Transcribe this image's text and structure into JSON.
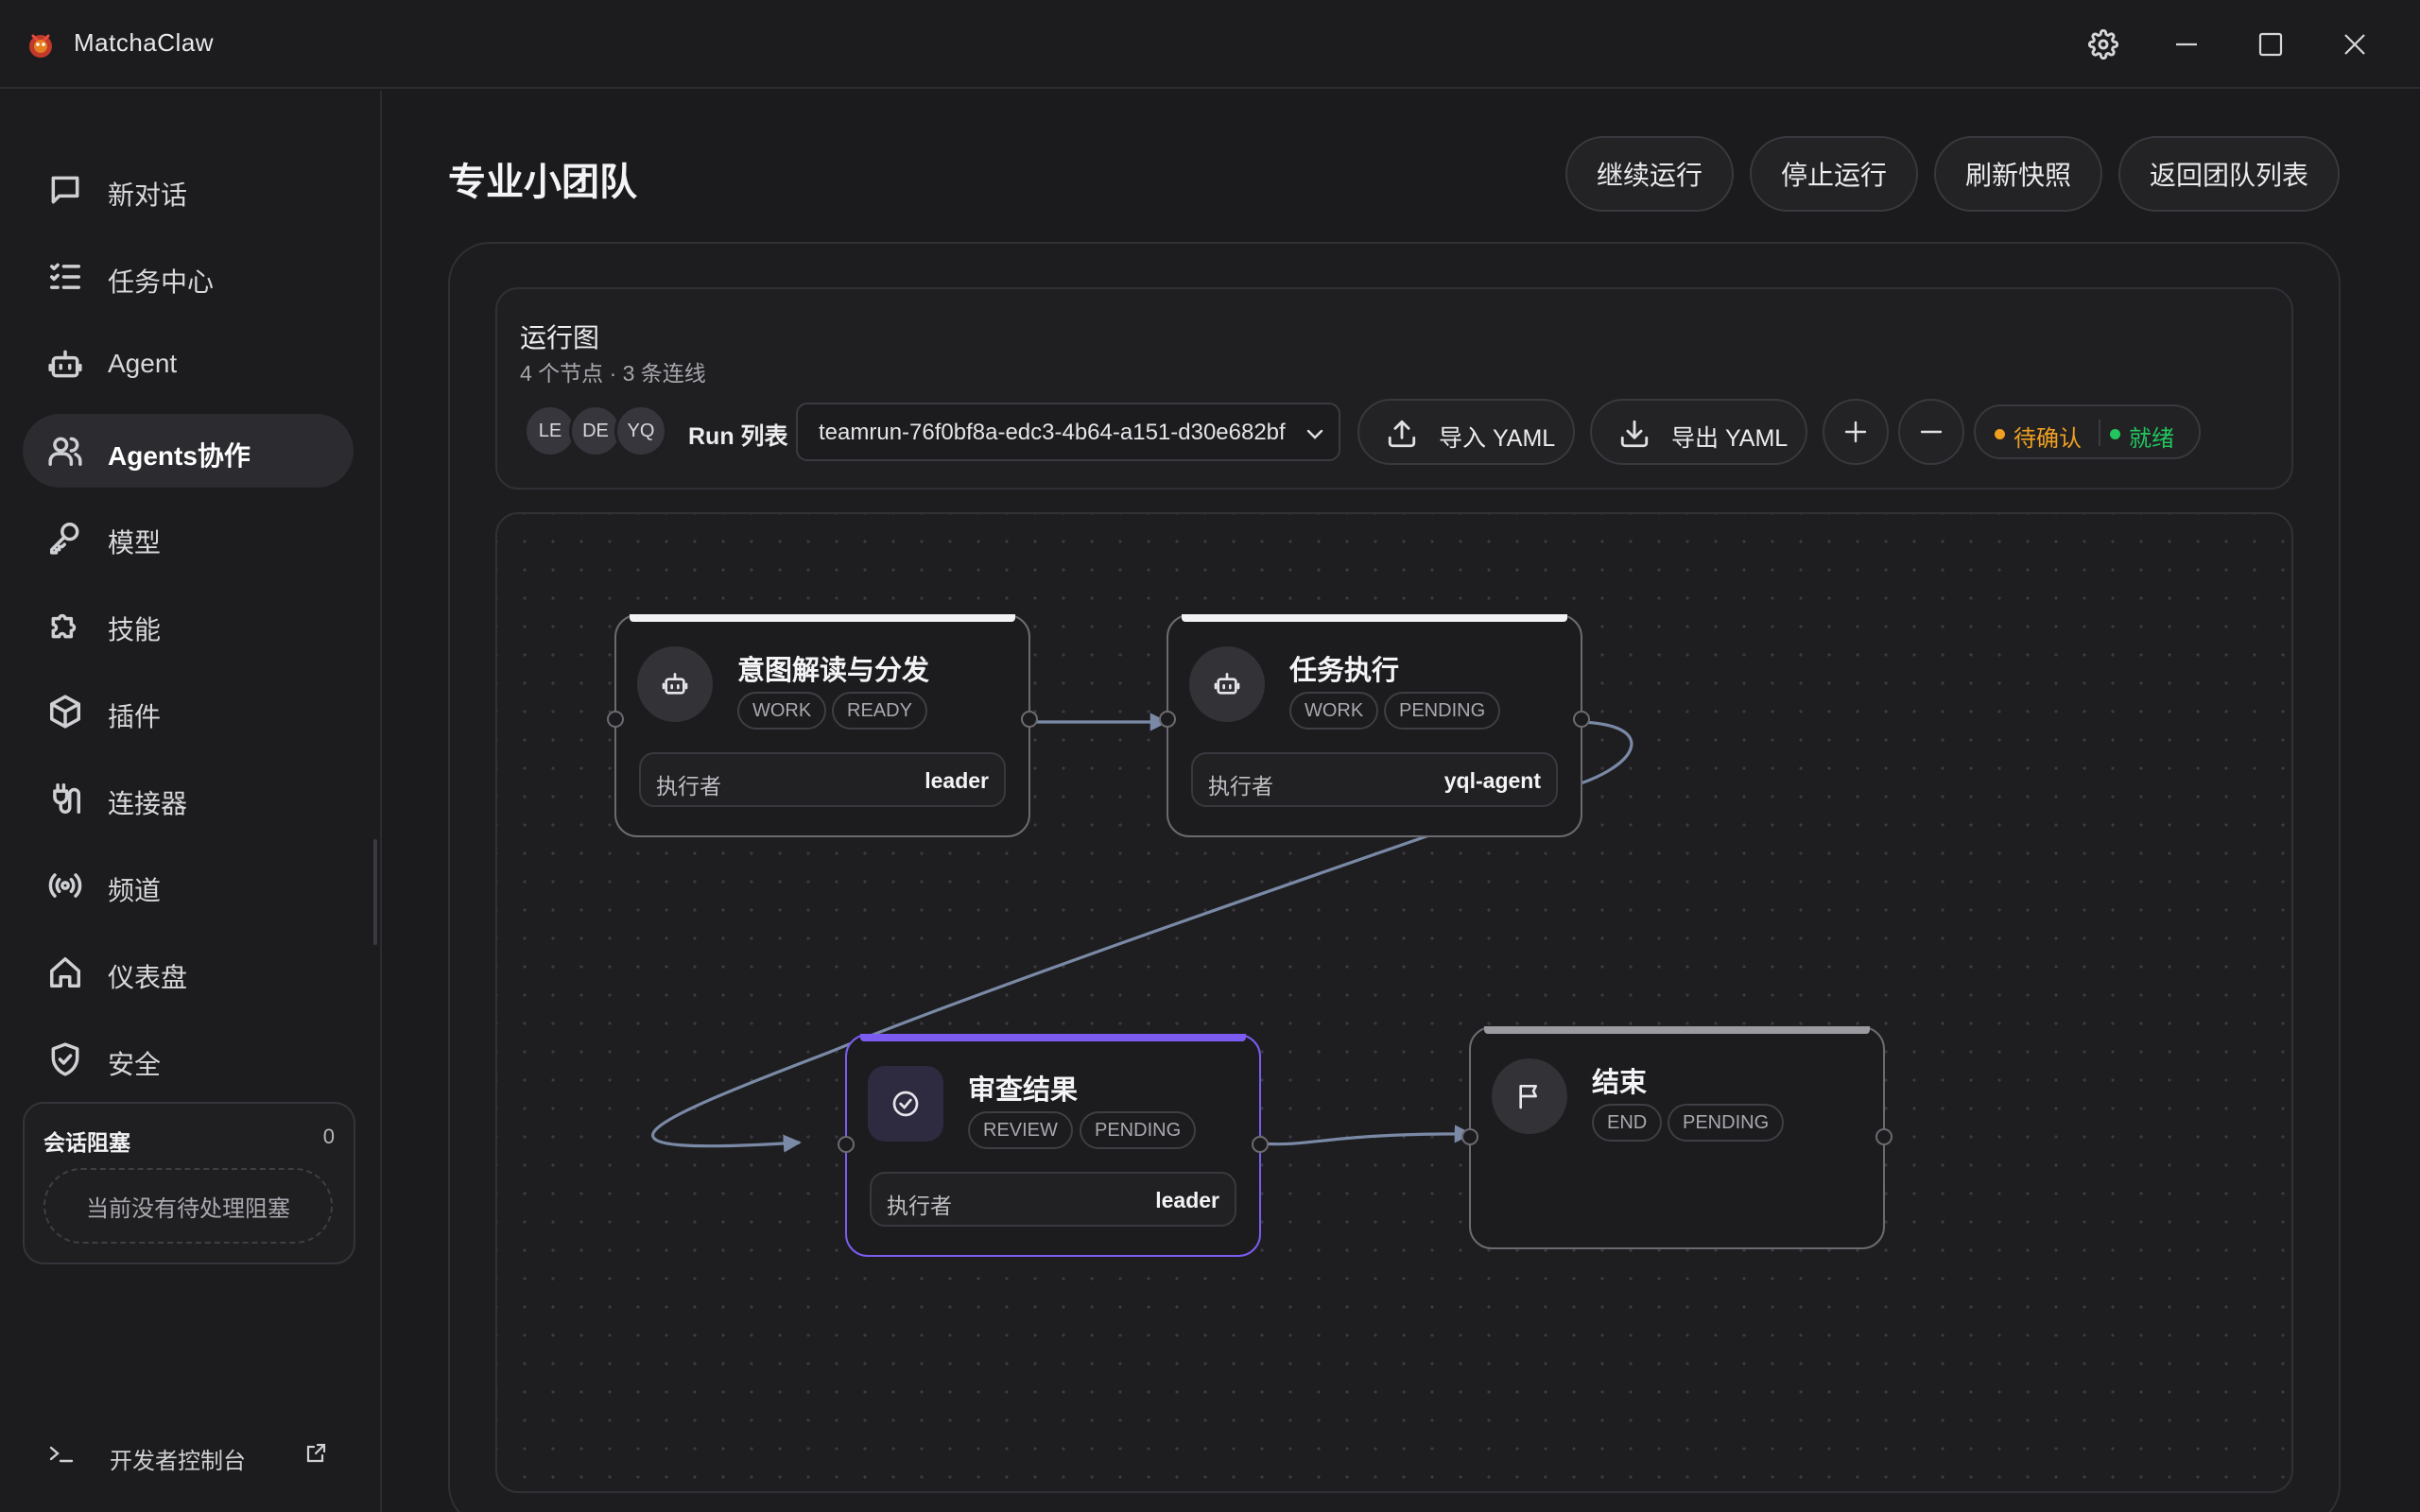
{
  "app": {
    "title": "MatchaClaw"
  },
  "window_controls": [
    "gear-icon",
    "minimize-icon",
    "maximize-icon",
    "close-icon"
  ],
  "sidebar": {
    "items": [
      {
        "label": "新对话",
        "icon": "chat-icon"
      },
      {
        "label": "任务中心",
        "icon": "checklist-icon"
      },
      {
        "label": "Agent",
        "icon": "robot-icon"
      },
      {
        "label": "Agents协作",
        "icon": "users-icon",
        "active": true
      },
      {
        "label": "模型",
        "icon": "key-icon"
      },
      {
        "label": "技能",
        "icon": "puzzle-icon"
      },
      {
        "label": "插件",
        "icon": "package-icon"
      },
      {
        "label": "连接器",
        "icon": "plug-icon"
      },
      {
        "label": "频道",
        "icon": "broadcast-icon"
      },
      {
        "label": "仪表盘",
        "icon": "home-icon"
      },
      {
        "label": "安全",
        "icon": "shield-icon"
      }
    ],
    "block_card": {
      "title": "会话阻塞",
      "count": "0",
      "empty": "当前没有待处理阻塞"
    },
    "dev_console": "开发者控制台"
  },
  "page": {
    "title": "专业小团队",
    "actions": [
      "继续运行",
      "停止运行",
      "刷新快照",
      "返回团队列表"
    ]
  },
  "graph": {
    "title": "运行图",
    "subtitle": "4 个节点 · 3 条连线",
    "avatars": [
      "LE",
      "DE",
      "YQ"
    ],
    "run_label": "Run 列表",
    "run_selected": "teamrun-76f0bf8a-edc3-4b64-a151-d30e682bf",
    "import_label": "导入 YAML",
    "export_label": "导出 YAML",
    "status": {
      "pending": "待确认",
      "ready": "就绪",
      "pending_color": "#f0a020",
      "ready_color": "#22c55e"
    },
    "accent_color": "#7c5cf0"
  },
  "nodes": [
    {
      "title": "意图解读与分发",
      "type": "WORK",
      "status": "READY",
      "executor_label": "执行者",
      "executor": "leader",
      "icon": "robot-icon"
    },
    {
      "title": "任务执行",
      "type": "WORK",
      "status": "PENDING",
      "executor_label": "执行者",
      "executor": "yql-agent",
      "icon": "robot-icon"
    },
    {
      "title": "审查结果",
      "type": "REVIEW",
      "status": "PENDING",
      "executor_label": "执行者",
      "executor": "leader",
      "icon": "check-circle-icon"
    },
    {
      "title": "结束",
      "type": "END",
      "status": "PENDING",
      "icon": "flag-icon"
    }
  ]
}
